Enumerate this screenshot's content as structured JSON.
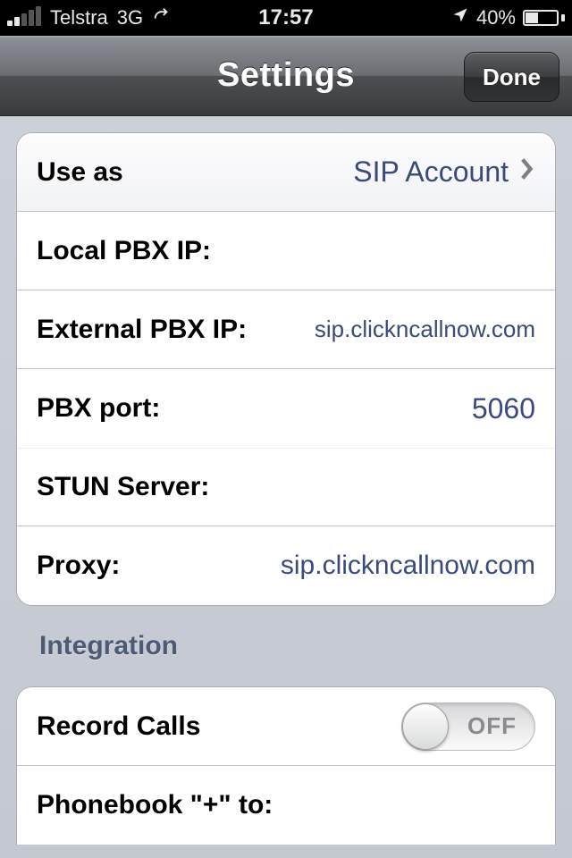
{
  "status": {
    "carrier": "Telstra",
    "network": "3G",
    "time": "17:57",
    "battery_pct": "40%"
  },
  "nav": {
    "title": "Settings",
    "done": "Done"
  },
  "settings_group": {
    "use_as": {
      "label": "Use as",
      "value": "SIP Account"
    },
    "local_pbx": {
      "label": "Local PBX IP:",
      "value": ""
    },
    "external_pbx": {
      "label": "External PBX IP:",
      "value": "sip.clickncallnow.com"
    },
    "pbx_port": {
      "label": "PBX port:",
      "value": "5060"
    },
    "stun": {
      "label": "STUN Server:",
      "value": ""
    },
    "proxy": {
      "label": "Proxy:",
      "value": "sip.clickncallnow.com"
    }
  },
  "integration": {
    "header": "Integration",
    "record_calls": {
      "label": "Record Calls",
      "state": "OFF"
    },
    "phonebook_plus": {
      "label": "Phonebook \"+\" to:",
      "value": ""
    }
  }
}
